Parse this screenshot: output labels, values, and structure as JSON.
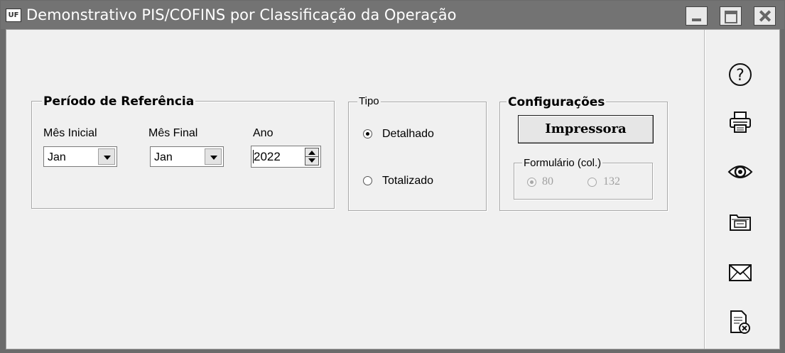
{
  "window": {
    "title": "Demonstrativo PIS/COFINS por Classificação da Operação",
    "app_icon_text": "UF"
  },
  "periodo": {
    "legend": "Período de Referência",
    "mes_inicial": {
      "label": "Mês Inicial",
      "value": "Jan"
    },
    "mes_final": {
      "label": "Mês Final",
      "value": "Jan"
    },
    "ano": {
      "label": "Ano",
      "value": "2022"
    }
  },
  "tipo": {
    "legend": "Tipo",
    "options": [
      {
        "label": "Detalhado",
        "selected": true
      },
      {
        "label": "Totalizado",
        "selected": false
      }
    ]
  },
  "configuracoes": {
    "legend": "Configurações",
    "printer_button": "Impressora",
    "formulario": {
      "legend": "Formulário (col.)",
      "options": [
        {
          "label": "80",
          "selected": true,
          "enabled": false
        },
        {
          "label": "132",
          "selected": false,
          "enabled": false
        }
      ]
    }
  },
  "toolbar": {
    "icons": [
      "help-icon",
      "printer-icon",
      "preview-eye-icon",
      "print-folder-icon",
      "email-envelope-icon",
      "close-document-icon"
    ]
  }
}
